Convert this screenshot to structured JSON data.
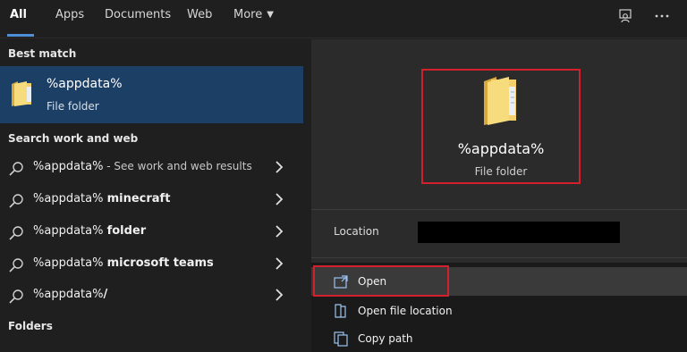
{
  "tabs": [
    {
      "label": "All",
      "active": true
    },
    {
      "label": "Apps"
    },
    {
      "label": "Documents"
    },
    {
      "label": "Web"
    },
    {
      "label": "More"
    }
  ],
  "top_icons": [
    "feedback-icon",
    "more-options-icon"
  ],
  "left": {
    "best_match_header": "Best match",
    "best_match": {
      "name": "%appdata%",
      "type": "File folder"
    },
    "search_header": "Search work and web",
    "results": [
      {
        "prefix": "%appdata%",
        "bold": "",
        "hint": " - See work and web results"
      },
      {
        "prefix": "%appdata% ",
        "bold": "minecraft",
        "hint": ""
      },
      {
        "prefix": "%appdata% ",
        "bold": "folder",
        "hint": ""
      },
      {
        "prefix": "%appdata% ",
        "bold": "microsoft teams",
        "hint": ""
      },
      {
        "prefix": "%appdata%",
        "bold": "/",
        "hint": ""
      }
    ],
    "folders_header": "Folders"
  },
  "right": {
    "preview": {
      "name": "%appdata%",
      "type": "File folder"
    },
    "location_label": "Location",
    "actions": [
      {
        "label": "Open",
        "icon": "open-icon"
      },
      {
        "label": "Open file location",
        "icon": "file-location-icon"
      },
      {
        "label": "Copy path",
        "icon": "copy-path-icon"
      }
    ]
  },
  "colors": {
    "accent": "#4f8fd8",
    "selection": "#1c3f66",
    "highlight_border": "#d41f2d"
  }
}
